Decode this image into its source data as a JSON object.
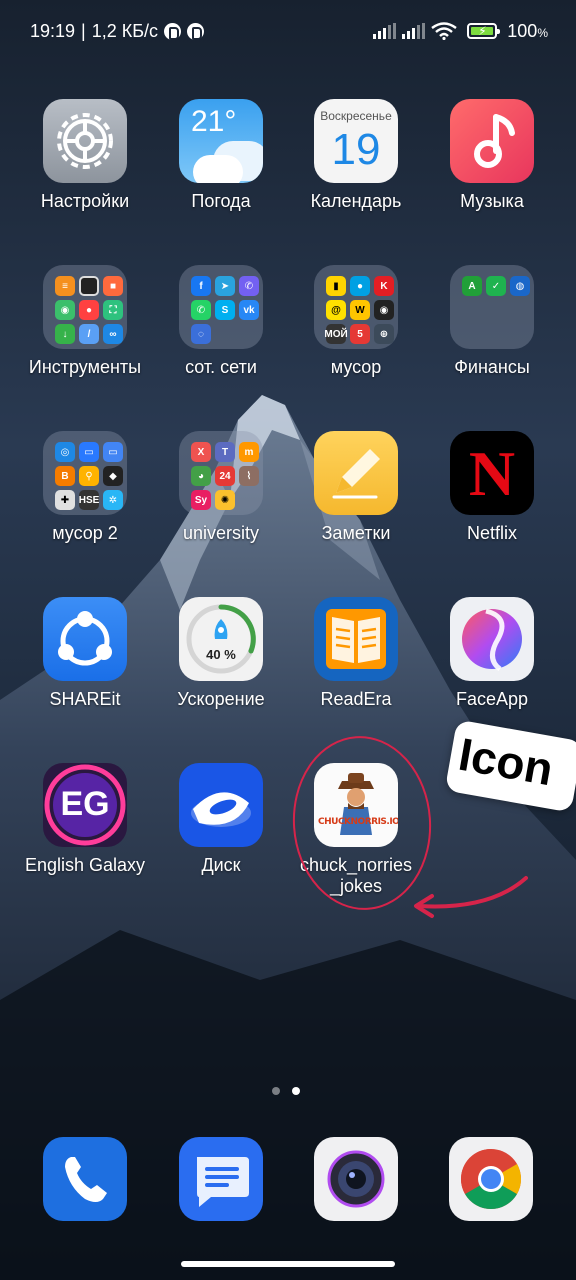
{
  "status_bar": {
    "time": "19:19",
    "separator": "|",
    "net_speed": "1,2 КБ/с",
    "battery_percent": "100",
    "battery_unit": "%"
  },
  "apps": [
    {
      "id": "settings",
      "label": "Настройки",
      "icon": "gear-icon"
    },
    {
      "id": "weather",
      "label": "Погода",
      "icon": "weather-icon",
      "temp": "21°"
    },
    {
      "id": "calendar",
      "label": "Календарь",
      "icon": "calendar-icon",
      "weekday": "Воскресенье",
      "day": "19"
    },
    {
      "id": "music",
      "label": "Музыка",
      "icon": "music-note-icon"
    },
    {
      "id": "tools",
      "label": "Инструменты",
      "icon": "folder-icon"
    },
    {
      "id": "social",
      "label": "сот. сети",
      "icon": "folder-icon"
    },
    {
      "id": "trash",
      "label": "мусор",
      "icon": "folder-icon"
    },
    {
      "id": "finance",
      "label": "Финансы",
      "icon": "folder-icon"
    },
    {
      "id": "trash2",
      "label": "мусор 2",
      "icon": "folder-icon"
    },
    {
      "id": "university",
      "label": "university",
      "icon": "folder-icon"
    },
    {
      "id": "notes",
      "label": "Заметки",
      "icon": "pencil-icon"
    },
    {
      "id": "netflix",
      "label": "Netflix",
      "icon": "netflix-icon",
      "letter": "N"
    },
    {
      "id": "shareit",
      "label": "SHAREit",
      "icon": "shareit-icon"
    },
    {
      "id": "boost",
      "label": "Ускорение",
      "icon": "rocket-icon",
      "percent": "40 %"
    },
    {
      "id": "readera",
      "label": "ReadEra",
      "icon": "book-icon"
    },
    {
      "id": "faceapp",
      "label": "FaceApp",
      "icon": "faceapp-icon"
    },
    {
      "id": "englishgalaxy",
      "label": "English Galaxy",
      "icon": "eg-icon",
      "letters": "EG"
    },
    {
      "id": "disk",
      "label": "Диск",
      "icon": "disk-icon"
    },
    {
      "id": "chuck",
      "label": "chuck_norries\n_jokes",
      "icon": "chuck-norris-icon",
      "logo_text": "CHUCKNORRIS.IO"
    }
  ],
  "annotation": {
    "sticker_text": "Icon",
    "color": "#d6244a"
  },
  "pages": {
    "count": 2,
    "current": 2
  },
  "dock": [
    {
      "id": "phone",
      "icon": "phone-icon"
    },
    {
      "id": "messages",
      "icon": "messages-icon"
    },
    {
      "id": "camera",
      "icon": "camera-icon"
    },
    {
      "id": "chrome",
      "icon": "chrome-icon"
    }
  ]
}
